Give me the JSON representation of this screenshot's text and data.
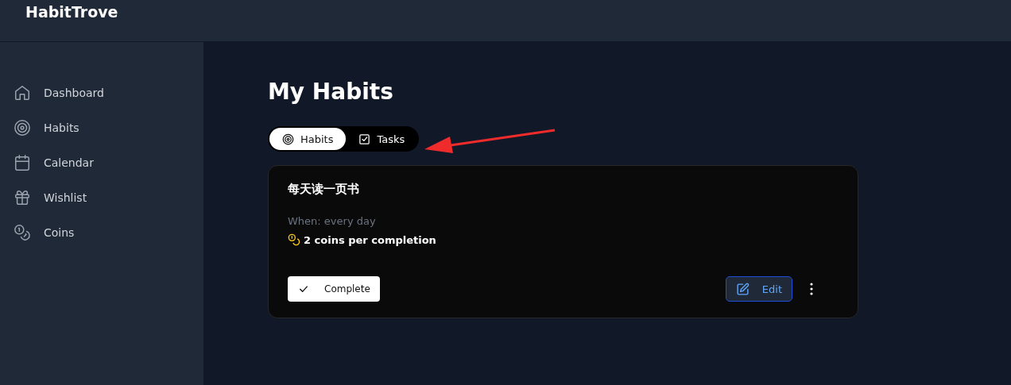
{
  "app": {
    "title": "HabitTrove"
  },
  "sidebar": {
    "items": [
      {
        "label": "Dashboard",
        "selected": false
      },
      {
        "label": "Habits",
        "selected": false
      },
      {
        "label": "Calendar",
        "selected": false
      },
      {
        "label": "Wishlist",
        "selected": false
      },
      {
        "label": "Coins",
        "selected": false
      }
    ]
  },
  "page": {
    "title": "My Habits"
  },
  "tabs": [
    {
      "label": "Habits",
      "selected": true
    },
    {
      "label": "Tasks",
      "selected": false
    }
  ],
  "habits": [
    {
      "name": "每天读一页书",
      "when": "When: every day",
      "coins": "2 coins per completion",
      "complete_label": "Complete",
      "edit_label": "Edit"
    }
  ]
}
